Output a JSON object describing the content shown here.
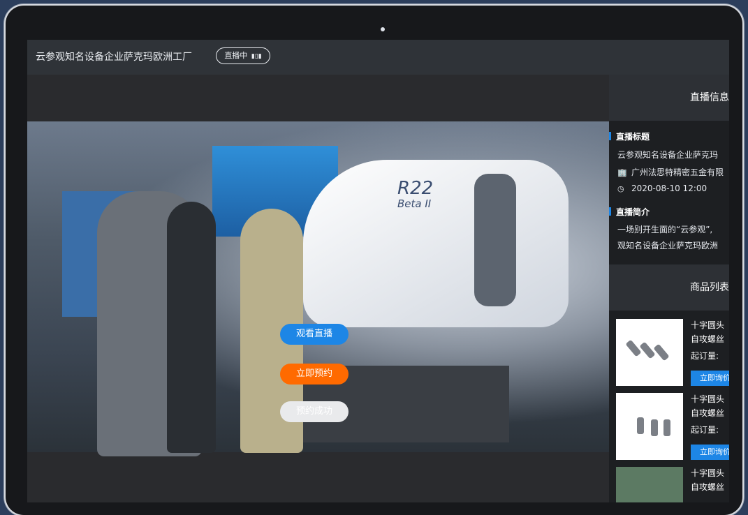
{
  "header": {
    "title": "云参观知名设备企业萨克玛欧洲工厂",
    "live_badge": "直播中",
    "live_badge_icon": "equalizer-icon"
  },
  "video": {
    "brand_text": "R22",
    "brand_sub": "Beta II",
    "actions": {
      "watch": "观看直播",
      "reserve": "立即预约",
      "reserved": "预约成功"
    }
  },
  "sidebar": {
    "info_header": "直播信息",
    "live_title_label": "直播标题",
    "live_title": "云参观知名设备企业萨克玛",
    "company": "广州法思特精密五金有限",
    "datetime": "2020-08-10  12:00",
    "intro_label": "直播简介",
    "intro_line1": "一场别开生面的“云参观”,",
    "intro_line2": "观知名设备企业萨克玛欧洲",
    "goods_header": "商品列表",
    "goods": [
      {
        "name_line1": "十字圆头",
        "name_line2": "自攻螺丝",
        "moq": "起订量:",
        "button": "立即询价"
      },
      {
        "name_line1": "十字圆头",
        "name_line2": "自攻螺丝",
        "moq": "起订量:",
        "button": "立即询价"
      },
      {
        "name_line1": "十字圆头",
        "name_line2": "自攻螺丝"
      }
    ]
  },
  "colors": {
    "accent_blue": "#1d86e6",
    "accent_orange": "#ff6a00"
  }
}
